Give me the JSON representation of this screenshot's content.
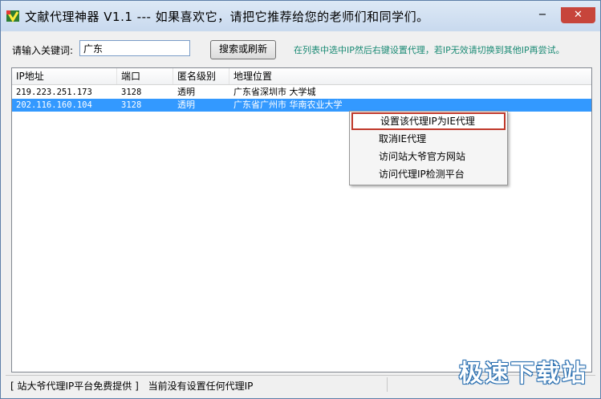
{
  "window": {
    "title": "文献代理神器 V1.1  ---  如果喜欢它，请把它推荐给您的老师们和同学们。",
    "minimize_glyph": "−",
    "maximize_glyph": "",
    "close_glyph": "✕"
  },
  "toolbar": {
    "keyword_label": "请输入关键词:",
    "keyword_value": "广东",
    "search_button": "搜索或刷新",
    "hint": "在列表中选中IP然后右键设置代理，若IP无效请切换到其他IP再尝试。"
  },
  "list": {
    "columns": [
      "IP地址",
      "端口",
      "匿名级别",
      "地理位置"
    ],
    "rows": [
      {
        "ip": "219.223.251.173",
        "port": "3128",
        "level": "透明",
        "location": "广东省深圳市 大学城",
        "selected": false
      },
      {
        "ip": "202.116.160.104",
        "port": "3128",
        "level": "透明",
        "location": "广东省广州市 华南农业大学",
        "selected": true
      }
    ]
  },
  "context_menu": {
    "items": [
      "设置该代理IP为IE代理",
      "取消IE代理",
      "访问站大爷官方网站",
      "访问代理IP检测平台"
    ]
  },
  "statusbar": {
    "left": "[ 站大爷代理IP平台免费提供 ]",
    "right": "当前没有设置任何代理IP"
  },
  "watermark": "极速下载站",
  "colors": {
    "selection": "#3399ff",
    "hint": "#1a8a74",
    "close_button": "#c7453b",
    "menu_highlight_border": "#c0392b"
  }
}
